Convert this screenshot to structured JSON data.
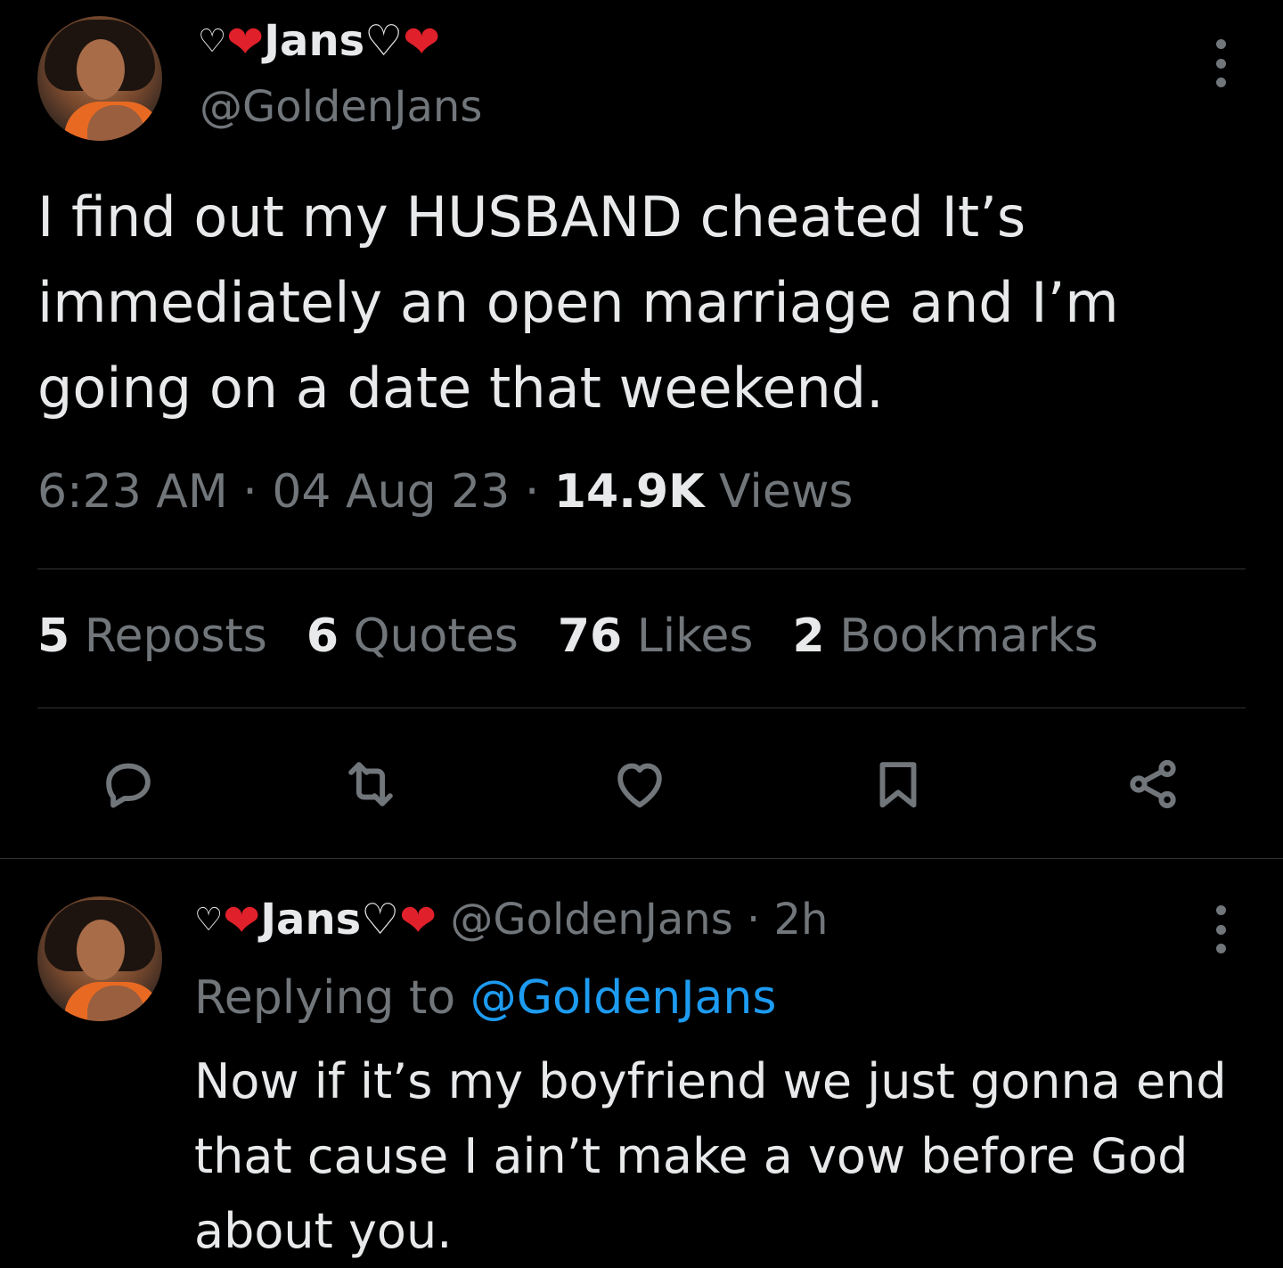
{
  "main_tweet": {
    "display_name_prefix": "♡",
    "display_name_heart": "❤",
    "display_name_text": "Jans♡",
    "display_name_heart_2": "❤",
    "handle": "@GoldenJans",
    "text": "I find out my HUSBAND cheated It’s immediately an open marriage and I’m going on a date that weekend.",
    "time": "6:23 AM",
    "date": "04 Aug 23",
    "views_count": "14.9K",
    "views_label": "Views",
    "separator": "·",
    "stats": {
      "reposts_count": "5",
      "reposts_label": "Reposts",
      "quotes_count": "6",
      "quotes_label": "Quotes",
      "likes_count": "76",
      "likes_label": "Likes",
      "bookmarks_count": "2",
      "bookmarks_label": "Bookmarks"
    },
    "actions": [
      "reply-icon",
      "repost-icon",
      "like-icon",
      "bookmark-icon",
      "share-icon"
    ]
  },
  "reply": {
    "display_name_prefix": "♡",
    "display_name_heart": "❤",
    "display_name_text": "Jans♡",
    "display_name_heart_2": "❤",
    "handle": "@GoldenJans",
    "separator": "·",
    "time_ago": "2h",
    "replying_label": "Replying to",
    "replying_handle": "@GoldenJans",
    "text": "Now if it’s my boyfriend we just gonna end that cause I ain’t make a vow before God about you."
  },
  "colors": {
    "background": "#000000",
    "text_primary": "#e7e9ea",
    "text_secondary": "#71767b",
    "link": "#1d9bf0",
    "heart": "#e0202a",
    "divider": "#2f3336"
  }
}
